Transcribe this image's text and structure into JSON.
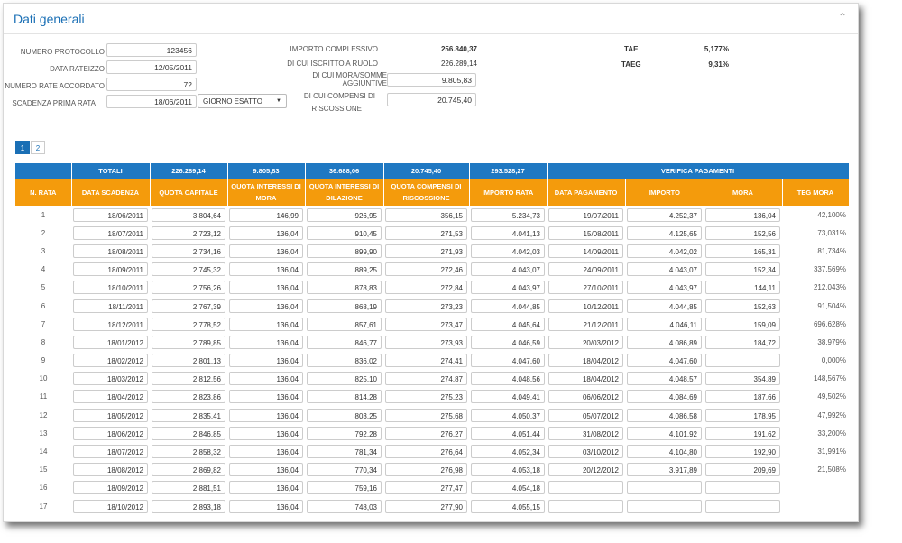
{
  "header": {
    "title": "Dati generali"
  },
  "form": {
    "numero_protocollo": {
      "label": "NUMERO PROTOCOLLO",
      "value": "123456"
    },
    "data_rateizzo": {
      "label": "DATA RATEIZZO",
      "value": "12/05/2011"
    },
    "numero_rate": {
      "label": "NUMERO RATE ACCORDATO",
      "value": "72"
    },
    "scadenza": {
      "label": "SCADENZA PRIMA RATA",
      "value": "18/06/2011",
      "select": "GIORNO ESATTO"
    }
  },
  "importi": {
    "complessivo": {
      "label": "IMPORTO COMPLESSIVO",
      "value": "256.840,37"
    },
    "iscritto": {
      "label": "DI CUI ISCRITTO A RUOLO",
      "value": "226.289,14"
    },
    "mora": {
      "label1": "DI CUI MORA/SOMME",
      "label2": "AGGIUNTIVE",
      "value": "9.805,83"
    },
    "compensi": {
      "label1": "DI CUI COMPENSI DI",
      "label2": "RISCOSSIONE",
      "value": "20.745,40"
    }
  },
  "rates": {
    "tae": {
      "label": "TAE",
      "value": "5,177%"
    },
    "taeg": {
      "label": "TAEG",
      "value": "9,31%"
    }
  },
  "pagination": {
    "pages": [
      "1",
      "2"
    ],
    "active": "1"
  },
  "table": {
    "totals": {
      "label": "TOTALI",
      "quota_capitale": "226.289,14",
      "quota_interessi_mora": "9.805,83",
      "quota_interessi_dilazione": "36.688,06",
      "quota_compensi": "20.745,40",
      "importo_rata": "293.528,27",
      "verifica": "VERIFICA PAGAMENTI"
    },
    "columns": [
      "N. RATA",
      "DATA SCADENZA",
      "QUOTA CAPITALE",
      "QUOTA INTERESSI DI MORA",
      "QUOTA INTERESSI DI DILAZIONE",
      "QUOTA COMPENSI DI RISCOSSIONE",
      "IMPORTO RATA",
      "DATA PAGAMENTO",
      "IMPORTO",
      "MORA",
      "TEG MORA"
    ],
    "rows": [
      [
        "1",
        "18/06/2011",
        "3.804,64",
        "146,99",
        "926,95",
        "356,15",
        "5.234,73",
        "19/07/2011",
        "4.252,37",
        "136,04",
        "42,100%"
      ],
      [
        "2",
        "18/07/2011",
        "2.723,12",
        "136,04",
        "910,45",
        "271,53",
        "4.041,13",
        "15/08/2011",
        "4.125,65",
        "152,56",
        "73,031%"
      ],
      [
        "3",
        "18/08/2011",
        "2.734,16",
        "136,04",
        "899,90",
        "271,93",
        "4.042,03",
        "14/09/2011",
        "4.042,02",
        "165,31",
        "81,734%"
      ],
      [
        "4",
        "18/09/2011",
        "2.745,32",
        "136,04",
        "889,25",
        "272,46",
        "4.043,07",
        "24/09/2011",
        "4.043,07",
        "152,34",
        "337,569%"
      ],
      [
        "5",
        "18/10/2011",
        "2.756,26",
        "136,04",
        "878,83",
        "272,84",
        "4.043,97",
        "27/10/2011",
        "4.043,97",
        "144,11",
        "212,043%"
      ],
      [
        "6",
        "18/11/2011",
        "2.767,39",
        "136,04",
        "868,19",
        "273,23",
        "4.044,85",
        "10/12/2011",
        "4.044,85",
        "152,63",
        "91,504%"
      ],
      [
        "7",
        "18/12/2011",
        "2.778,52",
        "136,04",
        "857,61",
        "273,47",
        "4.045,64",
        "21/12/2011",
        "4.046,11",
        "159,09",
        "696,628%"
      ],
      [
        "8",
        "18/01/2012",
        "2.789,85",
        "136,04",
        "846,77",
        "273,93",
        "4.046,59",
        "20/03/2012",
        "4.086,89",
        "184,72",
        "38,979%"
      ],
      [
        "9",
        "18/02/2012",
        "2.801,13",
        "136,04",
        "836,02",
        "274,41",
        "4.047,60",
        "18/04/2012",
        "4.047,60",
        "",
        "0,000%"
      ],
      [
        "10",
        "18/03/2012",
        "2.812,56",
        "136,04",
        "825,10",
        "274,87",
        "4.048,56",
        "18/04/2012",
        "4.048,57",
        "354,89",
        "148,567%"
      ],
      [
        "11",
        "18/04/2012",
        "2.823,86",
        "136,04",
        "814,28",
        "275,23",
        "4.049,41",
        "06/06/2012",
        "4.084,69",
        "187,66",
        "49,502%"
      ],
      [
        "12",
        "18/05/2012",
        "2.835,41",
        "136,04",
        "803,25",
        "275,68",
        "4.050,37",
        "05/07/2012",
        "4.086,58",
        "178,95",
        "47,992%"
      ],
      [
        "13",
        "18/06/2012",
        "2.846,85",
        "136,04",
        "792,28",
        "276,27",
        "4.051,44",
        "31/08/2012",
        "4.101,92",
        "191,62",
        "33,200%"
      ],
      [
        "14",
        "18/07/2012",
        "2.858,32",
        "136,04",
        "781,34",
        "276,64",
        "4.052,34",
        "03/10/2012",
        "4.104,80",
        "192,90",
        "31,991%"
      ],
      [
        "15",
        "18/08/2012",
        "2.869,82",
        "136,04",
        "770,34",
        "276,98",
        "4.053,18",
        "20/12/2012",
        "3.917,89",
        "209,69",
        "21,508%"
      ],
      [
        "16",
        "18/09/2012",
        "2.881,51",
        "136,04",
        "759,16",
        "277,47",
        "4.054,18",
        "",
        "",
        "",
        ""
      ],
      [
        "17",
        "18/10/2012",
        "2.893,18",
        "136,04",
        "748,03",
        "277,90",
        "4.055,15",
        "",
        "",
        "",
        ""
      ]
    ]
  }
}
